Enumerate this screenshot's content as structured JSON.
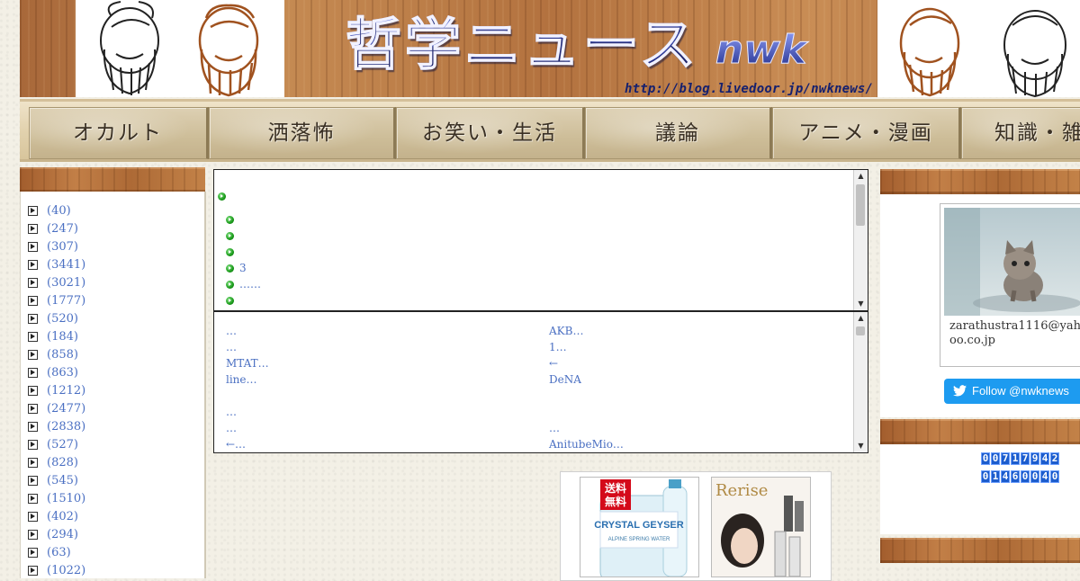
{
  "header": {
    "title": "哲学ニュース",
    "tag": "nwk",
    "url": "http://blog.livedoor.jp/nwknews/"
  },
  "nav": {
    "items": [
      {
        "label": "オカルト"
      },
      {
        "label": "洒落怖"
      },
      {
        "label": "お笑い・生活"
      },
      {
        "label": "議論"
      },
      {
        "label": "アニメ・漫画"
      },
      {
        "label": "知識・雑"
      }
    ]
  },
  "sidebar": {
    "categories": [
      {
        "count": "(40)"
      },
      {
        "count": "(247)"
      },
      {
        "count": "(307)"
      },
      {
        "count": "(3441)"
      },
      {
        "count": "(3021)"
      },
      {
        "count": "(1777)"
      },
      {
        "count": "(520)"
      },
      {
        "count": "(184)"
      },
      {
        "count": "(858)"
      },
      {
        "count": "(863)"
      },
      {
        "count": "(1212)"
      },
      {
        "count": "(2477)"
      },
      {
        "count": "(2838)"
      },
      {
        "count": "(527)"
      },
      {
        "count": "(828)"
      },
      {
        "count": "(545)"
      },
      {
        "count": "(1510)"
      },
      {
        "count": "(402)"
      },
      {
        "count": "(294)"
      },
      {
        "count": "(63)"
      },
      {
        "count": "(1022)"
      }
    ]
  },
  "news_box": {
    "rows": [
      "",
      "",
      "",
      "",
      "3",
      "……",
      ""
    ]
  },
  "links_box": {
    "left": [
      "…",
      "…",
      "MTAT…",
      "line…",
      "",
      "…",
      "…",
      "←…"
    ],
    "right": [
      "AKB…",
      "1…",
      "←",
      "DeNA",
      "",
      "",
      "…",
      "AnitubeMio…"
    ]
  },
  "ads": {
    "ad1_badge": "送料\n無料",
    "ad1_brand": "CRYSTAL GEYSER",
    "ad1_sub": "ALPINE SPRING WATER",
    "ad2_brand": "Rerise"
  },
  "profile": {
    "email": "zarathustra1116@yahoo.co.jp"
  },
  "twitter": {
    "label": "Follow @nwknews"
  },
  "counters": {
    "total": "00717942",
    "second": "01460040"
  },
  "colors": {
    "link": "#4a6fc2",
    "twitter": "#1d9bf0",
    "counter": "#1c5ccc",
    "wood": "#b3723f"
  }
}
